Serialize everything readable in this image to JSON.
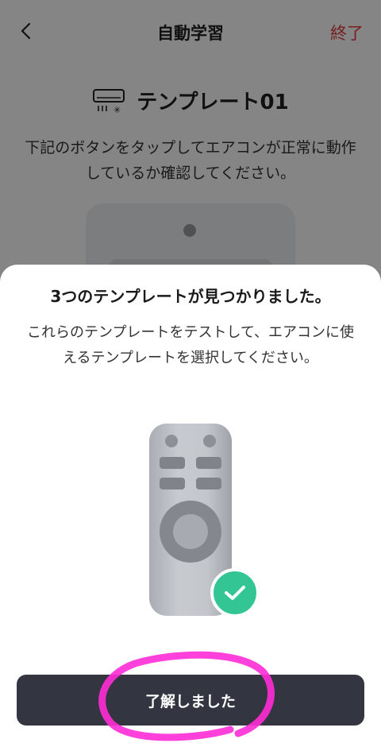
{
  "header": {
    "title": "自動学習",
    "end_label": "終了"
  },
  "template": {
    "name": "テンプレート01",
    "instruction": "下記のボタンをタップしてエアコンが正常に動作しているか確認してください。"
  },
  "dialog": {
    "title": "3つのテンプレートが見つかりました。",
    "description": "これらのテンプレートをテストして、エアコンに使えるテンプレートを選択してください。",
    "confirm_label": "了解しました"
  },
  "colors": {
    "end_text": "#e23b3b",
    "confirm_button": "#333641",
    "check_badge": "#33c694",
    "annotation_stroke": "#ff2bd6"
  },
  "icons": {
    "back": "chevron-left-icon",
    "air_conditioner": "air-conditioner-icon",
    "remote": "remote-control-illustration",
    "check": "check-icon"
  }
}
